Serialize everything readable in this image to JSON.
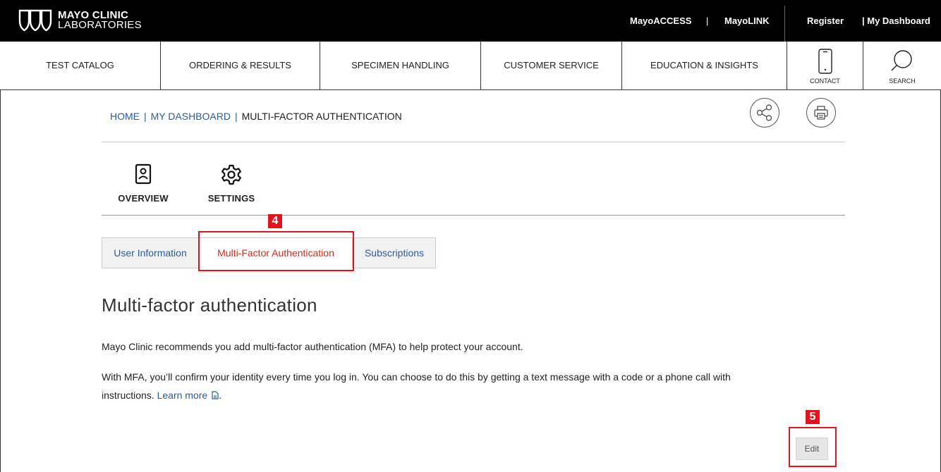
{
  "logo": {
    "line1": "MAYO CLINIC",
    "line2": "LABORATORIES"
  },
  "topbar": {
    "links": [
      "MayoACCESS",
      "MayoLINK"
    ],
    "separator": "|",
    "register": "Register",
    "my_dashboard": "| My Dashboard"
  },
  "nav": {
    "items": [
      "TEST CATALOG",
      "ORDERING & RESULTS",
      "SPECIMEN HANDLING",
      "CUSTOMER SERVICE",
      "EDUCATION & INSIGHTS"
    ],
    "contact": "CONTACT",
    "search": "SEARCH"
  },
  "breadcrumb": {
    "home": "HOME",
    "dashboard": "MY DASHBOARD",
    "current": "MULTI-FACTOR AUTHENTICATION",
    "sep": "|"
  },
  "dashboard_tabs": {
    "overview": "OVERVIEW",
    "settings": "SETTINGS"
  },
  "subtabs": [
    {
      "label": "User Information",
      "active": false
    },
    {
      "label": "Multi-Factor Authentication",
      "active": true
    },
    {
      "label": "Subscriptions",
      "active": false
    }
  ],
  "annotations": {
    "tab_marker": "4",
    "edit_marker": "5",
    "color": "#e0141d"
  },
  "content": {
    "heading": "Multi-factor authentication",
    "para1": "Mayo Clinic recommends you add multi-factor authentication (MFA) to help protect your account.",
    "para2_line1": "With MFA, you’ll confirm your identity every time you log in. You can choose to do this by getting a text message with a code or a phone call with",
    "para2_line2": "instructions.",
    "learn_more": "Learn more",
    "period": ".",
    "edit": "Edit"
  },
  "colors": {
    "link": "#2a5b9a",
    "active_tab": "#d52b1e",
    "topbar": "#000000"
  },
  "icons": [
    "mayo-shields-logo-icon",
    "phone-icon",
    "search-icon",
    "share-icon",
    "print-icon",
    "user-badge-icon",
    "gear-icon",
    "document-icon"
  ]
}
